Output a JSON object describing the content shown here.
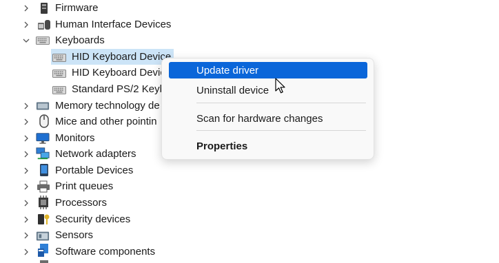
{
  "tree": {
    "items": [
      {
        "label": "Firmware",
        "icon": "firmware-icon",
        "expanded": false
      },
      {
        "label": "Human Interface Devices",
        "icon": "hid-icon",
        "expanded": false
      },
      {
        "label": "Keyboards",
        "icon": "keyboard-icon",
        "expanded": true
      },
      {
        "label": "HID Keyboard Device",
        "icon": "keyboard-icon",
        "child": true,
        "selected": true
      },
      {
        "label": "HID Keyboard Devic",
        "icon": "keyboard-icon",
        "child": true
      },
      {
        "label": "Standard PS/2 Keyb",
        "icon": "keyboard-icon",
        "child": true
      },
      {
        "label": "Memory technology de",
        "icon": "memory-icon",
        "expanded": false
      },
      {
        "label": "Mice and other pointin",
        "icon": "mouse-icon",
        "expanded": false
      },
      {
        "label": "Monitors",
        "icon": "monitor-icon",
        "expanded": false
      },
      {
        "label": "Network adapters",
        "icon": "network-icon",
        "expanded": false
      },
      {
        "label": "Portable Devices",
        "icon": "portable-device-icon",
        "expanded": false
      },
      {
        "label": "Print queues",
        "icon": "printer-icon",
        "expanded": false
      },
      {
        "label": "Processors",
        "icon": "processor-icon",
        "expanded": false
      },
      {
        "label": "Security devices",
        "icon": "security-device-icon",
        "expanded": false
      },
      {
        "label": "Sensors",
        "icon": "sensor-icon",
        "expanded": false
      },
      {
        "label": "Software components",
        "icon": "software-component-icon",
        "expanded": false
      }
    ]
  },
  "context_menu": {
    "update_driver": "Update driver",
    "uninstall_device": "Uninstall device",
    "scan_hardware": "Scan for hardware changes",
    "properties": "Properties"
  },
  "colors": {
    "menu_highlight": "#0a66d9",
    "selection": "#cce4f7"
  }
}
